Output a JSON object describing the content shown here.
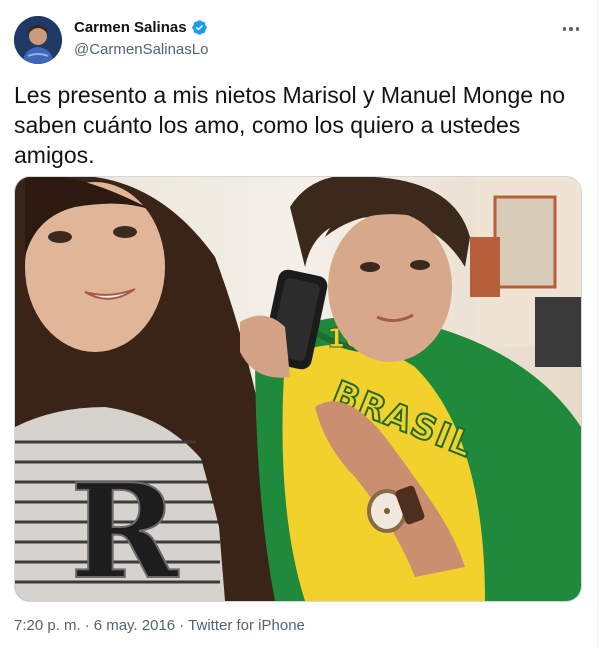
{
  "author": {
    "display_name": "Carmen Salinas",
    "handle": "@CarmenSalinasLo",
    "verified": true
  },
  "tweet": {
    "text": "Les presento a mis nietos Marisol y Manuel Monge no saben cuánto los amo, como los quiero a ustedes amigos."
  },
  "media": {
    "shirt_lettering": "BRASIL",
    "shirt_number": "10"
  },
  "meta": {
    "time": "7:20 p. m.",
    "separator": "·",
    "date": "6 may. 2016",
    "separator2": "·",
    "source": "Twitter for iPhone"
  },
  "colors": {
    "verified_blue": "#1d9bf0",
    "secondary_text": "#536471",
    "primary_text": "#0f1419",
    "border": "#cfd9de"
  },
  "icons": {
    "verified": "verified-badge-icon",
    "more": "more-options-icon"
  }
}
